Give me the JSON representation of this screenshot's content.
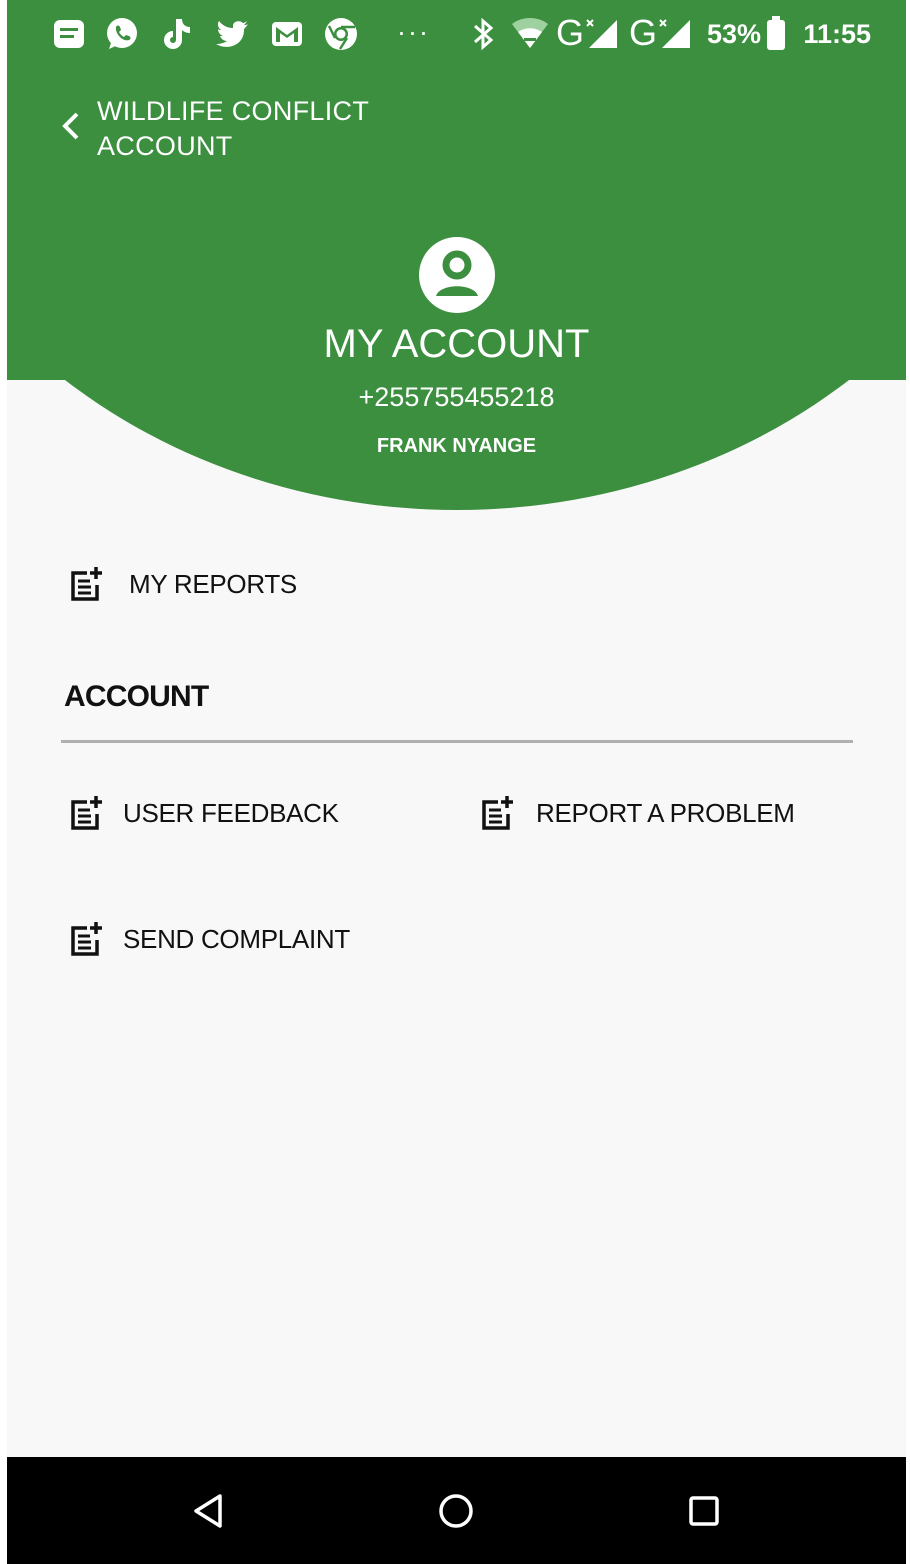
{
  "status_bar": {
    "battery_percent": "53%",
    "time": "11:55",
    "network_1": "G",
    "network_2": "G",
    "more": "···",
    "icons": [
      "notes-icon",
      "whatsapp-icon",
      "tiktok-icon",
      "twitter-icon",
      "gmail-icon",
      "chrome-icon",
      "bluetooth-icon",
      "wifi-icon",
      "signal-icon",
      "battery-icon"
    ]
  },
  "app_bar": {
    "title_line1": "WILDLIFE CONFLICT",
    "title_line2": "ACCOUNT"
  },
  "profile": {
    "title": "MY ACCOUNT",
    "phone": "+255755455218",
    "name": "FRANK NYANGE"
  },
  "menu": {
    "my_reports": "MY REPORTS",
    "section_account": "ACCOUNT",
    "user_feedback": "USER FEEDBACK",
    "report_problem": "REPORT A PROBLEM",
    "send_complaint": "SEND COMPLAINT"
  },
  "colors": {
    "primary": "#3b8f3f",
    "background": "#f8f8f8",
    "text": "#111111"
  }
}
